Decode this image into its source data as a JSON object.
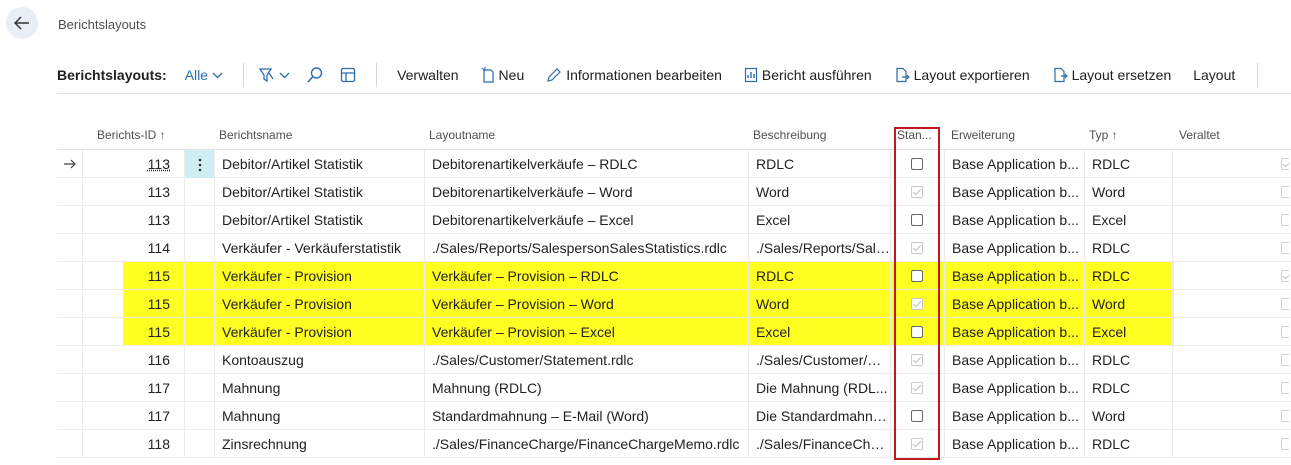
{
  "page": {
    "title": "Berichtslayouts"
  },
  "actionbar": {
    "label": "Berichtslayouts:",
    "view": "Alle",
    "buttons": {
      "manage": "Verwalten",
      "new": "Neu",
      "edit_info": "Informationen bearbeiten",
      "run_report": "Bericht ausführen",
      "export_layout": "Layout exportieren",
      "replace_layout": "Layout ersetzen",
      "layout": "Layout"
    }
  },
  "colors": {
    "highlight": "#ffff22",
    "frame": "#c0181e",
    "accent": "#2b6cb0"
  },
  "columns": {
    "report_id": "Berichts-ID ↑",
    "report_name": "Berichtsname",
    "layout_name": "Layoutname",
    "description": "Beschreibung",
    "standard": "Stan...",
    "extension": "Erweiterung",
    "type": "Typ ↑",
    "obsolete": "Veraltet"
  },
  "rows": [
    {
      "id": "113",
      "name": "Debitor/Artikel Statistik",
      "layout": "Debitorenartikelverkäufe – RDLC",
      "desc": "RDLC",
      "standard": false,
      "ext": "Base Application b...",
      "type": "RDLC",
      "obsolete": true
    },
    {
      "id": "113",
      "name": "Debitor/Artikel Statistik",
      "layout": "Debitorenartikelverkäufe – Word",
      "desc": "Word",
      "standard": true,
      "ext": "Base Application b...",
      "type": "Word",
      "obsolete": false
    },
    {
      "id": "113",
      "name": "Debitor/Artikel Statistik",
      "layout": "Debitorenartikelverkäufe – Excel",
      "desc": "Excel",
      "standard": false,
      "ext": "Base Application b...",
      "type": "Excel",
      "obsolete": false
    },
    {
      "id": "114",
      "name": "Verkäufer - Verkäuferstatistik",
      "layout": "./Sales/Reports/SalespersonSalesStatistics.rdlc",
      "desc": "./Sales/Reports/Sale...",
      "standard": true,
      "ext": "Base Application b...",
      "type": "RDLC",
      "obsolete": false
    },
    {
      "id": "115",
      "name": "Verkäufer - Provision",
      "layout": "Verkäufer – Provision – RDLC",
      "desc": "RDLC",
      "standard": false,
      "ext": "Base Application b...",
      "type": "RDLC",
      "obsolete": true
    },
    {
      "id": "115",
      "name": "Verkäufer - Provision",
      "layout": "Verkäufer – Provision – Word",
      "desc": "Word",
      "standard": true,
      "ext": "Base Application b...",
      "type": "Word",
      "obsolete": false
    },
    {
      "id": "115",
      "name": "Verkäufer - Provision",
      "layout": "Verkäufer – Provision – Excel",
      "desc": "Excel",
      "standard": false,
      "ext": "Base Application b...",
      "type": "Excel",
      "obsolete": false
    },
    {
      "id": "116",
      "name": "Kontoauszug",
      "layout": "./Sales/Customer/Statement.rdlc",
      "desc": "./Sales/Customer/St...",
      "standard": true,
      "ext": "Base Application b...",
      "type": "RDLC",
      "obsolete": false
    },
    {
      "id": "117",
      "name": "Mahnung",
      "layout": "Mahnung (RDLC)",
      "desc": "Die Mahnung (RDL...",
      "standard": true,
      "ext": "Base Application b...",
      "type": "RDLC",
      "obsolete": false
    },
    {
      "id": "117",
      "name": "Mahnung",
      "layout": "Standardmahnung – E-Mail (Word)",
      "desc": "Die Standardmahnu...",
      "standard": false,
      "ext": "Base Application b...",
      "type": "Word",
      "obsolete": false
    },
    {
      "id": "118",
      "name": "Zinsrechnung",
      "layout": "./Sales/FinanceCharge/FinanceChargeMemo.rdlc",
      "desc": "./Sales/FinanceChar...",
      "standard": true,
      "ext": "Base Application b...",
      "type": "RDLC",
      "obsolete": false
    }
  ]
}
